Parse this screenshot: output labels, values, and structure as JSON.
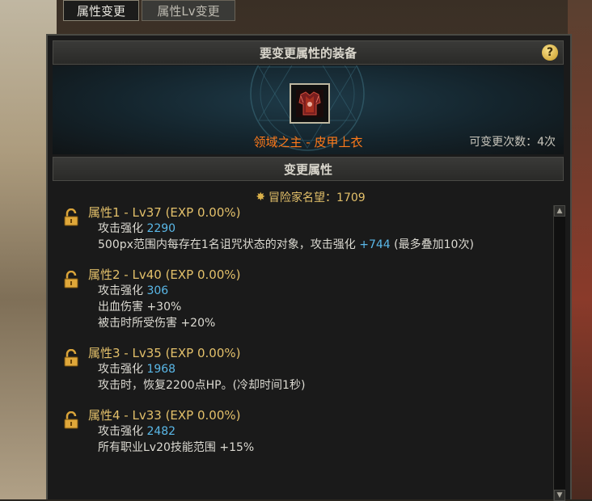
{
  "tabs": [
    {
      "label": "属性变更"
    },
    {
      "label": "属性Lv变更"
    }
  ],
  "window": {
    "header_title": "要变更属性的装备",
    "help_label": "?",
    "item_name": "领域之主 - 皮甲上衣",
    "change_count": "可变更次数：4次",
    "section_title": "变更属性",
    "reputation": "冒险家名望：1709"
  },
  "attributes": [
    {
      "title": "属性1 - Lv37 (EXP 0.00%)",
      "lines": [
        {
          "text": "攻击强化",
          "value": "2290"
        },
        {
          "text": "500px范围内每存在1名诅咒状态的对象，攻击强化",
          "value": "+744",
          "suffix": "(最多叠加10次)"
        }
      ]
    },
    {
      "title": "属性2 - Lv40 (EXP 0.00%)",
      "lines": [
        {
          "text": "攻击强化",
          "value": "306"
        },
        {
          "text": "出血伤害 +30%"
        },
        {
          "text": "被击时所受伤害 +20%"
        }
      ]
    },
    {
      "title": "属性3 - Lv35 (EXP 0.00%)",
      "lines": [
        {
          "text": "攻击强化",
          "value": "1968"
        },
        {
          "text": "攻击时，恢复2200点HP。(冷却时间1秒)"
        }
      ]
    },
    {
      "title": "属性4 - Lv33 (EXP 0.00%)",
      "lines": [
        {
          "text": "攻击强化",
          "value": "2482"
        },
        {
          "text": "所有职业Lv20技能范围 +15%"
        }
      ]
    }
  ],
  "colors": {
    "accent_gold": "#e3c06a",
    "item_orange": "#ff7a1a",
    "value_blue": "#5ab8e8"
  }
}
